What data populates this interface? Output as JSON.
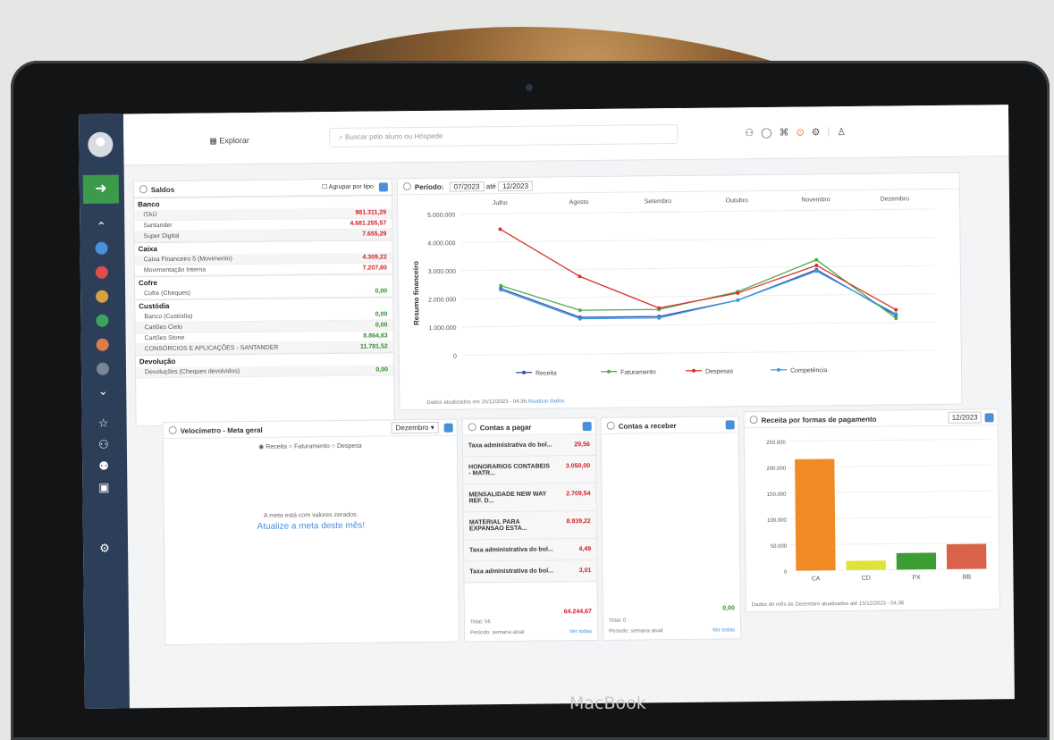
{
  "topbar": {
    "explore": "Explorar",
    "search_placeholder": "Buscar pelo aluno ou Hóspede"
  },
  "saldos": {
    "title": "Saldos",
    "group_label": "Agrupar por tipo",
    "sections": [
      {
        "name": "Banco",
        "rows": [
          {
            "label": "ITAÚ",
            "value": "981.311,29",
            "kind": "neg"
          },
          {
            "label": "Santander",
            "value": "4.681.255,57",
            "kind": "neg"
          },
          {
            "label": "Super Digital",
            "value": "7.655,29",
            "kind": "neg"
          }
        ]
      },
      {
        "name": "Caixa",
        "rows": [
          {
            "label": "Caixa Financeiro 5 (Movimento)",
            "value": "4.309,22",
            "kind": "neg"
          },
          {
            "label": "Movimentação Interna",
            "value": "7.207,80",
            "kind": "neg"
          }
        ]
      },
      {
        "name": "Cofre",
        "rows": [
          {
            "label": "Cofre (Cheques)",
            "value": "0,00",
            "kind": "pos"
          }
        ]
      },
      {
        "name": "Custódia",
        "rows": [
          {
            "label": "Banco (Custódia)",
            "value": "0,00",
            "kind": "pos"
          },
          {
            "label": "Cartões Cielo",
            "value": "0,00",
            "kind": "pos"
          },
          {
            "label": "Cartões Stone",
            "value": "8.864,83",
            "kind": "pos"
          },
          {
            "label": "CONSÓRCIOS E APLICAÇÕES - SANTANDER",
            "value": "11.781,52",
            "kind": "pos"
          }
        ]
      },
      {
        "name": "Devolução",
        "rows": [
          {
            "label": "Devoluções (Cheques devolvidos)",
            "value": "0,00",
            "kind": "pos"
          }
        ]
      }
    ]
  },
  "periodo": {
    "label": "Período:",
    "from": "07/2023",
    "ate": "até",
    "to": "12/2023",
    "footer": "Dados atualizados em 15/12/2023 - 04:36",
    "footer_link": "Atualizar dados"
  },
  "chart_data": {
    "type": "line",
    "categories": [
      "Julho",
      "Agosto",
      "Setembro",
      "Outubro",
      "Novembro",
      "Dezembro"
    ],
    "ylabel": "Resumo financeiro",
    "yticks": [
      "5.000.000",
      "4.000.000",
      "3.000.000",
      "2.000.000",
      "1.000.000",
      "0"
    ],
    "ylim": [
      0,
      5000000
    ],
    "legend_position": "bottom",
    "series": [
      {
        "name": "Receita",
        "color": "#3a4fa8",
        "values": [
          2350000,
          1300000,
          1300000,
          1850000,
          2900000,
          1250000
        ]
      },
      {
        "name": "Faturamento",
        "color": "#4caf50",
        "values": [
          2450000,
          1550000,
          1550000,
          2150000,
          3250000,
          1150000
        ]
      },
      {
        "name": "Despesas",
        "color": "#d9342b",
        "values": [
          4450000,
          2750000,
          1600000,
          2100000,
          3050000,
          1450000
        ]
      },
      {
        "name": "Competência",
        "color": "#3b9ae1",
        "values": [
          2300000,
          1250000,
          1250000,
          1850000,
          2850000,
          1300000
        ]
      }
    ]
  },
  "velocimetro": {
    "title": "Velocímetro - Meta geral",
    "month": "Dezembro",
    "options": [
      "Receita",
      "Faturamento",
      "Despesa"
    ],
    "msg1": "A meta está com valores zerados.",
    "msg2": "Atualize a meta deste mês!"
  },
  "contas_pagar": {
    "title": "Contas a pagar",
    "items": [
      {
        "label": "Taxa administrativa do bol...",
        "value": "29,56"
      },
      {
        "label": "HONORARIOS CONTABEIS - MATR...",
        "value": "3.050,00"
      },
      {
        "label": "MENSALIDADE NEW WAY REF. D...",
        "value": "2.709,54"
      },
      {
        "label": "MATERIAL PARA EXPANSAO ESTA...",
        "value": "8.939,22"
      },
      {
        "label": "Taxa administrativa do bol...",
        "value": "4,49"
      },
      {
        "label": "Taxa administrativa do bol...",
        "value": "3,01"
      }
    ],
    "total_value": "64.244,67",
    "total": "Total: 56",
    "period": "Período: semana atual",
    "link": "Ver todas"
  },
  "contas_receber": {
    "title": "Contas a receber",
    "value": "0,00",
    "total": "Total: 0",
    "period": "Período: semana atual",
    "link": "Ver todas"
  },
  "receita_formas": {
    "title": "Receita por formas de pagamento",
    "month": "12/2023",
    "footer": "Dados do mês de Dezembro atualizados até 15/12/2023 - 04:36",
    "chart_data": {
      "type": "bar",
      "categories": [
        "CA",
        "CD",
        "PX",
        "BB"
      ],
      "values": [
        215000,
        18000,
        32000,
        48000
      ],
      "colors": [
        "#f08a24",
        "#dfe23a",
        "#3e9c35",
        "#d9634a"
      ],
      "yticks": [
        "250.000",
        "200.000",
        "150.000",
        "100.000",
        "50.000",
        "0"
      ],
      "ylim": [
        0,
        250000
      ]
    }
  },
  "brand": "MacBook"
}
